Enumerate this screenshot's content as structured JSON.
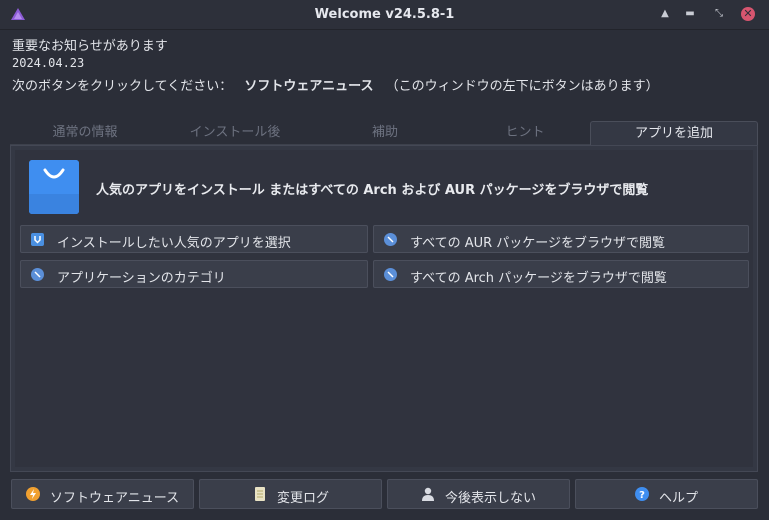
{
  "window": {
    "title": "Welcome v24.5.8-1",
    "controls": [
      "arrow-up-icon",
      "minimize-icon",
      "restore-icon",
      "close-icon"
    ]
  },
  "notice": {
    "line1": "重要なお知らせがあります",
    "date": "2024.04.23",
    "prefix": "次のボタンをクリックしてください：",
    "highlight": "ソフトウェアニュース",
    "suffix": "（このウィンドウの左下にボタンはあります）"
  },
  "tabs": [
    {
      "label": "通常の情報",
      "active": false
    },
    {
      "label": "インストール後",
      "active": false
    },
    {
      "label": "補助",
      "active": false
    },
    {
      "label": "ヒント",
      "active": false
    },
    {
      "label": "アプリを追加",
      "active": true
    }
  ],
  "add_apps": {
    "heading": "人気のアプリをインストール またはすべての Arch および AUR パッケージをブラウザで閲覧",
    "options": [
      {
        "label": "インストールしたい人気のアプリを選択",
        "icon": "install-icon"
      },
      {
        "label": "すべての AUR パッケージをブラウザで閲覧",
        "icon": "compass-icon"
      },
      {
        "label": "アプリケーションのカテゴリ",
        "icon": "compass-icon"
      },
      {
        "label": "すべての Arch パッケージをブラウザで閲覧",
        "icon": "compass-icon"
      }
    ]
  },
  "footer": {
    "buttons": [
      {
        "label": "ソフトウェアニュース",
        "icon": "news-icon"
      },
      {
        "label": "変更ログ",
        "icon": "changelog-icon"
      },
      {
        "label": "今後表示しない",
        "icon": "user-icon"
      },
      {
        "label": "ヘルプ",
        "icon": "help-icon"
      }
    ]
  },
  "colors": {
    "background": "#2b2e38",
    "accent": "#3f8ef0",
    "close": "#d6556f",
    "news_icon": "#f0a030"
  }
}
